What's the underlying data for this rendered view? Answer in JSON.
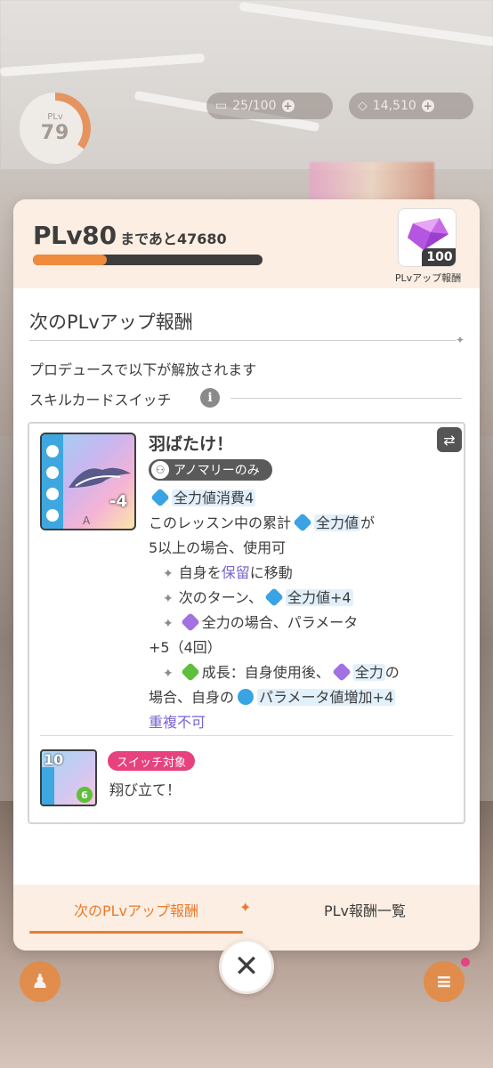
{
  "hud": {
    "plv_current_label": "PLv",
    "plv_current": "79",
    "stamina": "25/100",
    "gems": "14,510"
  },
  "dialog": {
    "plv_prefix": "PLv",
    "plv_next": "80",
    "remaining_label": "まであと",
    "remaining_value": "47680",
    "xp_progress": 0.32,
    "reward_count": "100",
    "reward_caption": "PLvアップ報酬",
    "section_title": "次のPLvアップ報酬",
    "unlock_text": "プロデュースで以下が解放されます",
    "switch_label": "スキルカードスイッチ",
    "card": {
      "name": "羽ばたけ！",
      "cost": "-4",
      "grade": "A",
      "badge": "アノマリーのみ",
      "line1": "全力値消費4",
      "line2a": "このレッスン中の累計",
      "line2b": "全力値",
      "line2c": "が",
      "line3": "5以上の場合、使用可",
      "line4a": "自身を",
      "line4b": "保留",
      "line4c": "に移動",
      "line5a": "次のターン、",
      "line5b": "全力値+4",
      "line6a": "全力の場合、パラメータ",
      "line7": "+5（4回）",
      "line8a": "成長：自身使用後、",
      "line8b": "全力",
      "line8c": "の",
      "line9a": "場合、自身の",
      "line9b": "パラメータ値増加+4",
      "line10": "重複不可"
    },
    "switch_target": {
      "level": "10",
      "cost_badge": "6",
      "badge": "スイッチ対象",
      "name": "翔び立て！"
    },
    "tabs": [
      {
        "label": "次のPLvアップ報酬"
      },
      {
        "label": "PLv報酬一覧"
      }
    ]
  },
  "colors": {
    "accent": "#e97b2e",
    "header_bg": "#fceee2",
    "pink_badge": "#e6427e",
    "highlight": "#7a63d1"
  },
  "icons": [
    "close-icon",
    "info-icon",
    "swap-icon",
    "gem-icon",
    "stamina-icon"
  ]
}
